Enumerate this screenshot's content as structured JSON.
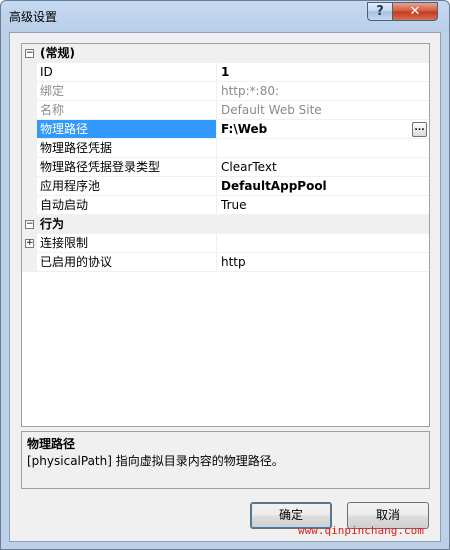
{
  "window": {
    "title": "高级设置"
  },
  "titlebar": {
    "help_glyph": "?",
    "close_glyph": "✕"
  },
  "grid": {
    "rows": [
      {
        "type": "category",
        "expander": "−",
        "name": "(常规)"
      },
      {
        "type": "prop",
        "name": "ID",
        "value": "1",
        "style": "bold"
      },
      {
        "type": "prop",
        "name": "绑定",
        "value": "http:*:80:",
        "style": "gray"
      },
      {
        "type": "prop",
        "name": "名称",
        "value": "Default Web Site",
        "style": "gray"
      },
      {
        "type": "prop",
        "name": "物理路径",
        "value": "F:\\Web",
        "style": "bold",
        "selected": true,
        "ellipsis": "..."
      },
      {
        "type": "prop",
        "name": "物理路径凭据",
        "value": ""
      },
      {
        "type": "prop",
        "name": "物理路径凭据登录类型",
        "value": "ClearText"
      },
      {
        "type": "prop",
        "name": "应用程序池",
        "value": "DefaultAppPool",
        "style": "bold"
      },
      {
        "type": "prop",
        "name": "自动启动",
        "value": "True"
      },
      {
        "type": "category",
        "expander": "−",
        "name": "行为"
      },
      {
        "type": "prop",
        "name": "连接限制",
        "value": "",
        "expander": "+"
      },
      {
        "type": "prop",
        "name": "已启用的协议",
        "value": "http"
      }
    ]
  },
  "description": {
    "title": "物理路径",
    "text": "[physicalPath] 指向虚拟目录内容的物理路径。"
  },
  "buttons": {
    "ok": "确定",
    "cancel": "取消"
  },
  "watermark": "www.qinpinchang.com"
}
